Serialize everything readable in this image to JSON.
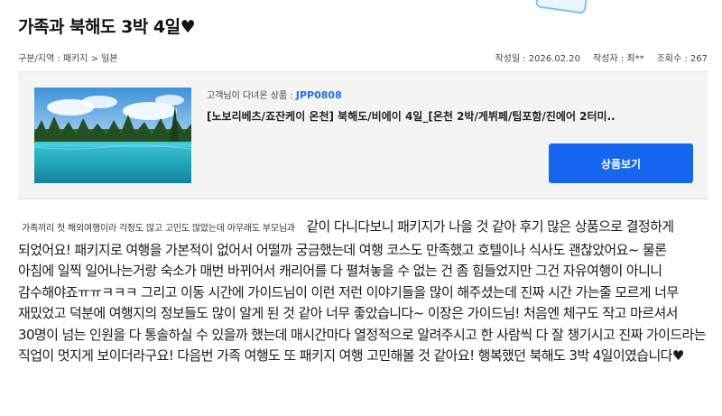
{
  "review": {
    "title": "가족과 북해도 3박 4일♥",
    "category": "구분/지역 : 패키지 > 일본",
    "meta": [
      {
        "text": "작성일 : 2026.02.20"
      },
      {
        "text": "작성자 : 최**"
      },
      {
        "text": "조회수 : 267"
      }
    ],
    "intro_small": "가족끼리 첫 해외여행이라 걱정도 많고 고민도 많았는데 아무래도 부모님과",
    "body": "같이 다니다보니 패키지가 나을 것 같아 후기 많은 상품으로 결정하게 되었어요! 패키지로 여행을 가본적이 없어서 어떨까 궁금했는데 여행 코스도 만족했고 호텔이나 식사도 괜찮았어요~ 물론 아침에 일찍 일어나는거랑 숙소가 매번 바뀌어서 캐리어를 다 펼쳐놓을 수 없는 건 좀 힘들었지만 그건 자유여행이 아니니 감수해야죠ㅠㅠㅋㅋㅋ 그리고 이동 시간에 가이드님이 이런 저런 이야기들을 많이 해주셨는데 진짜 시간 가는줄 모르게 너무 재밌었고 덕분에 여행지의 정보들도 많이 알게 된 것 같아 너무 좋았습니다~ 이장은 가이드님! 처음엔 체구도 작고 마르셔서 30명이 넘는 인원을 다 통솔하실 수 있을까 했는데 매시간마다 열정적으로 알려주시고 한 사람씩 다 잘 챙기시고 진짜 가이드라는 직업이 멋지게 보이더라구요! 다음번 가족 여행도 또 패키지 여행 고민해볼 것 같아요! 행복했던 북해도 3박 4일이였습니다♥"
  },
  "product": {
    "visited_label": "고객님이 다녀온 상품 : ",
    "code": "JPP0808",
    "name": "[노보리베츠/죠잔케이 온천] 북해도/비에이 4일_[온천 2박/게뷔페/팁포함/진에어 2터미..",
    "button_label": "상품보기",
    "thumbnail_icon": "lake-landscape-photo"
  },
  "colors": {
    "accent": "#1766f0",
    "code": "#1a73e8"
  }
}
